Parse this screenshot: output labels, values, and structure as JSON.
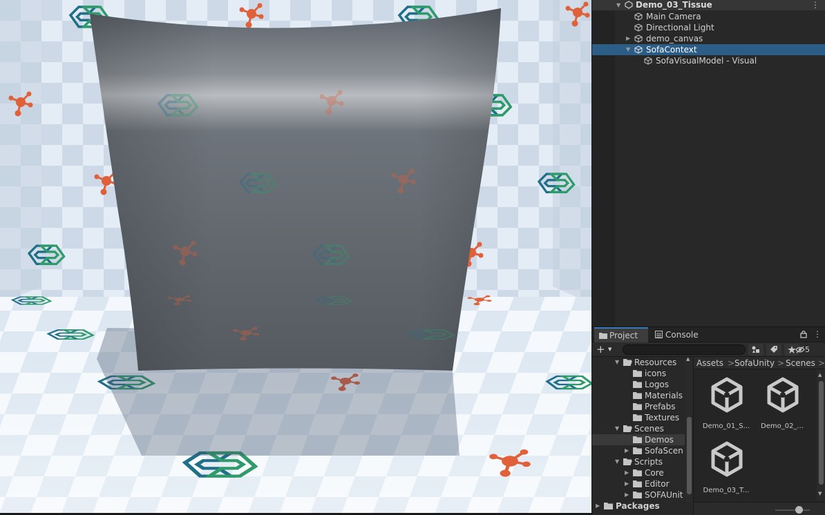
{
  "hierarchy": {
    "scene_name": "Demo_03_Tissue",
    "items": [
      {
        "label": "Main Camera"
      },
      {
        "label": "Directional Light"
      },
      {
        "label": "demo_canvas"
      },
      {
        "label": "SofaContext"
      },
      {
        "label": "SofaVisualModel - Visual"
      }
    ],
    "more_icon": "⋮"
  },
  "project": {
    "tabs": [
      {
        "label": "Project",
        "icon": "folder-icon"
      },
      {
        "label": "Console",
        "icon": "console-icon"
      }
    ],
    "add_label": "+",
    "search_placeholder": "",
    "hidden_count": "5",
    "tree": [
      {
        "label": "Resources"
      },
      {
        "label": "icons"
      },
      {
        "label": "Logos"
      },
      {
        "label": "Materials"
      },
      {
        "label": "Prefabs"
      },
      {
        "label": "Textures"
      },
      {
        "label": "Scenes"
      },
      {
        "label": "Demos"
      },
      {
        "label": "SofaScen"
      },
      {
        "label": "Scripts"
      },
      {
        "label": "Core"
      },
      {
        "label": "Editor"
      },
      {
        "label": "SOFAUnit"
      },
      {
        "label": "Packages"
      }
    ],
    "breadcrumb": [
      "Assets",
      "SofaUnity",
      "Scenes"
    ],
    "breadcrumb_sep": ">",
    "assets": [
      {
        "label": "Demo_01_S..."
      },
      {
        "label": "Demo_02_..."
      },
      {
        "label": "Demo_03_T..."
      }
    ],
    "zoom_level": 0.6
  },
  "colors": {
    "selection": "#2c5d87",
    "panel_bg": "#282828",
    "sofa_orange": "#e0603a",
    "sofa_teal": "#1f7d8a"
  }
}
